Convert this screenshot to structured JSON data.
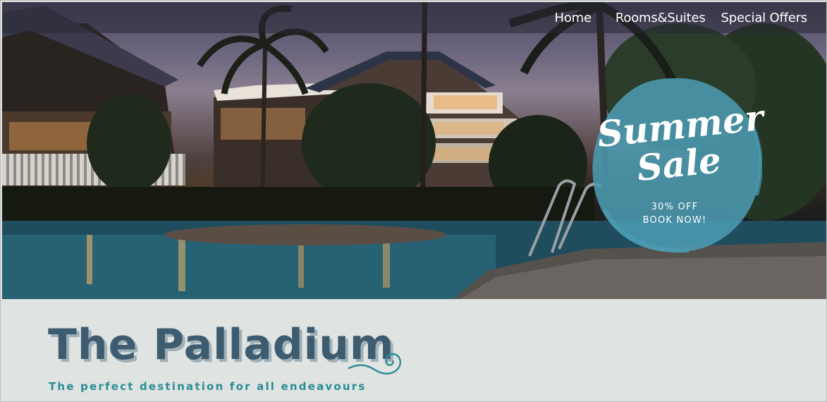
{
  "nav": {
    "items": [
      {
        "label": "Home"
      },
      {
        "label": "Rooms&Suites"
      },
      {
        "label": "Special Offers"
      }
    ]
  },
  "promo": {
    "title_line1": "Summer",
    "title_line2": "Sale",
    "discount": "30% OFF",
    "cta": "BOOK NOW!"
  },
  "brand": {
    "name": "The Palladium",
    "tagline": "The perfect destination for all endeavours"
  },
  "colors": {
    "brand_text": "#3e5c70",
    "tagline": "#2a8d95",
    "badge": "#4c9db5",
    "background": "#dfe3e1"
  },
  "icons": {
    "decoration": "swirl-flourish-icon"
  }
}
